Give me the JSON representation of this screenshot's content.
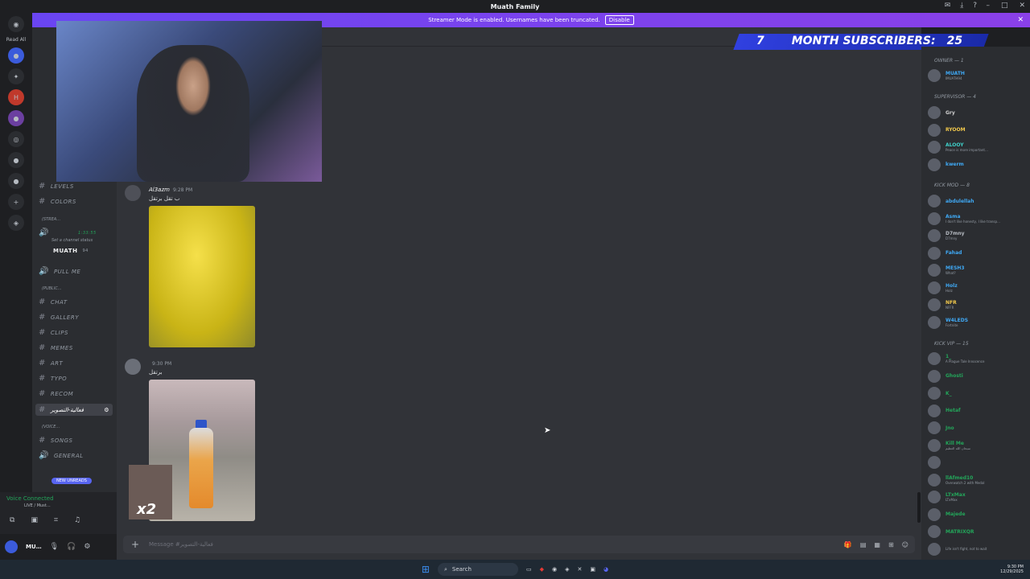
{
  "window": {
    "title": "Muath Family"
  },
  "banner": {
    "text": "Streamer Mode is enabled. Usernames have been truncated.",
    "disable_label": "Disable"
  },
  "guilds": {
    "read_all": "Read All"
  },
  "channels": {
    "levels": "LEVELS",
    "colors": "COLORS",
    "stream_cat": "(STREA…",
    "live_name": "MUATH",
    "live_badge": "94",
    "live_time": "1:33:55",
    "set_status": "Set a channel status",
    "pull_me": "PULL ME",
    "public_cat": "(PUBLIC…",
    "chat": "CHAT",
    "gallery": "GALLERY",
    "clips": "CLIPS",
    "memes": "MEMES",
    "art": "ART",
    "typo": "TYPO",
    "recom": "RECOM",
    "active": "فعالية-التصوير",
    "voice_cat": "(VOICE…",
    "songs": "SONGS",
    "general": "GENERAL",
    "new_unreads": "NEW UNREADS"
  },
  "userpanel": {
    "voice_connected": "Voice Connected",
    "voice_sub": "LIVE / Must…",
    "user": "MU…"
  },
  "messages": [
    {
      "author": "Al3azm",
      "time": "9:28 PM",
      "text": "ب تقل برتقل"
    },
    {
      "author": "",
      "time": "9:30 PM",
      "text": "برتقل"
    }
  ],
  "overlay": {
    "subs_number": "7",
    "subs_label": "MONTH SUBSCRIBERS:",
    "subs_count": "25",
    "multiplier": "x2"
  },
  "composer": {
    "placeholder": "Message #فعالية-التصوير"
  },
  "members": {
    "cats": {
      "owner": "OWNER — 1",
      "supervisor": "SUPERVISOR — 4",
      "kick_mod": "KICK MOD — 8",
      "kick_vip": "KICK VIP — 15"
    },
    "owner": [
      {
        "name": "MUATH",
        "status": "IMUATH94",
        "color": "#3fa9f5"
      }
    ],
    "supervisor": [
      {
        "name": "Gry",
        "status": "",
        "color": "#d0d0d0"
      },
      {
        "name": "RYOOM",
        "status": "",
        "color": "#f2c94c"
      },
      {
        "name": "ALOOY",
        "status": "Peace is more important…",
        "color": "#3fd0c9"
      },
      {
        "name": "kwerm",
        "status": "",
        "color": "#3fa9f5"
      }
    ],
    "kick_mod": [
      {
        "name": "abdulellah",
        "status": "",
        "color": "#3fa9f5"
      },
      {
        "name": "Asma",
        "status": "I don't like honesty, I like transp…",
        "color": "#3fa9f5"
      },
      {
        "name": "D7mny",
        "status": "D7mny",
        "color": "#b5bac1"
      },
      {
        "name": "Fahad",
        "status": "",
        "color": "#3fa9f5"
      },
      {
        "name": "MESH3",
        "status": "What?",
        "color": "#3fa9f5"
      },
      {
        "name": "Holz",
        "status": "Holz",
        "color": "#3fa9f5"
      },
      {
        "name": "NFR",
        "status": "NFFR",
        "color": "#f2c94c"
      },
      {
        "name": "W4LEDS",
        "status": "Fortnite",
        "color": "#3fa9f5"
      }
    ],
    "kick_vip": [
      {
        "name": "1_",
        "status": "A Plague Tale Innocence",
        "color": "#23a55a"
      },
      {
        "name": "Ghosti",
        "status": "",
        "color": "#23a55a"
      },
      {
        "name": "K_",
        "status": "",
        "color": "#23a55a"
      },
      {
        "name": "Hetaf",
        "status": "",
        "color": "#23a55a"
      },
      {
        "name": "Jno",
        "status": "",
        "color": "#23a55a"
      },
      {
        "name": "Kill Me",
        "status": "سبحان الله العظيم",
        "color": "#23a55a"
      },
      {
        "name": "",
        "status": "",
        "color": "#23a55a"
      },
      {
        "name": "llAfmed10",
        "status": "Overwatch 2 with Medal",
        "color": "#23a55a"
      },
      {
        "name": "LTxMax",
        "status": "LTxMax",
        "color": "#23a55a"
      },
      {
        "name": "Majede",
        "status": "",
        "color": "#23a55a"
      },
      {
        "name": "MATRIXQR",
        "status": "",
        "color": "#23a55a"
      },
      {
        "name": "",
        "status": "Life isn't fight, not to wait",
        "color": "#23a55a"
      }
    ]
  },
  "taskbar": {
    "search": "Search",
    "time": "9:30 PM",
    "date": "12/29/2025"
  }
}
